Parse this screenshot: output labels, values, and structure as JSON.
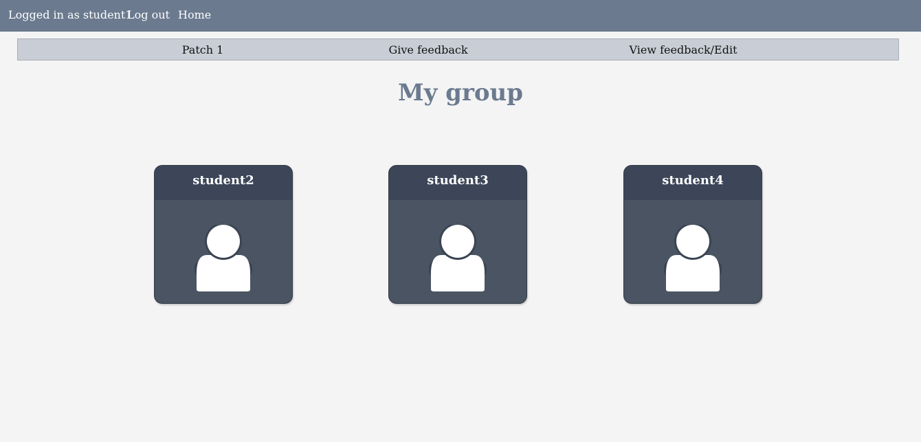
{
  "topbar": {
    "logged_in": "Logged in as student1",
    "logout": "Log out",
    "home": "Home"
  },
  "subnav": {
    "patch": "Patch 1",
    "give_feedback": "Give feedback",
    "view_feedback": "View feedback/Edit"
  },
  "page": {
    "title": "My group"
  },
  "group": {
    "members": [
      {
        "name": "student2",
        "icon": "user-avatar-icon"
      },
      {
        "name": "student3",
        "icon": "user-avatar-icon"
      },
      {
        "name": "student4",
        "icon": "user-avatar-icon"
      }
    ]
  },
  "colors": {
    "topbar": "#6b7a8f",
    "subnav": "#c9ced6",
    "title": "#6b7a8f",
    "card": "#4a5462",
    "card_header": "#3c4658"
  }
}
